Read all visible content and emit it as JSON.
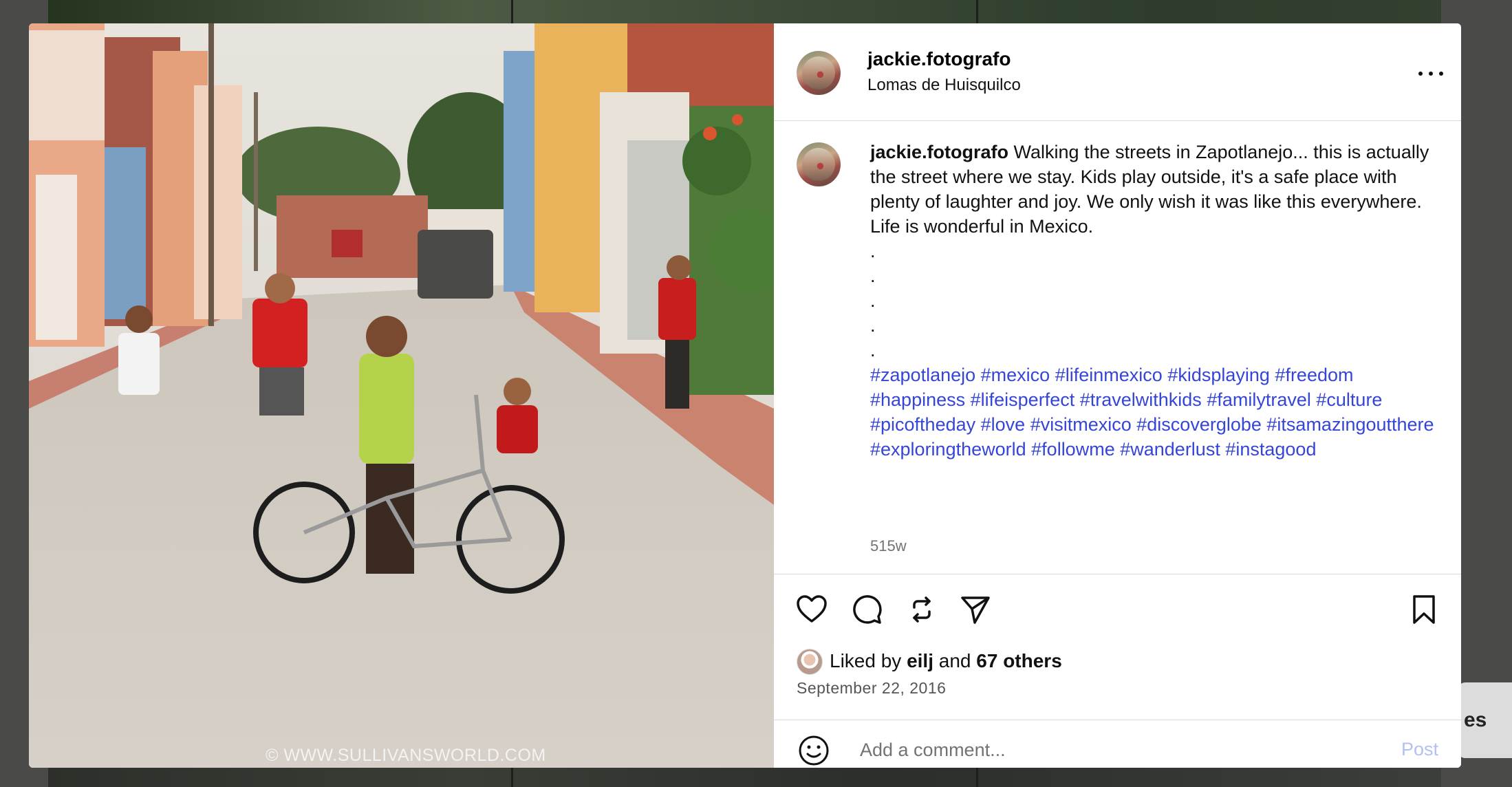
{
  "background": {
    "behind_text": "es"
  },
  "photo": {
    "alt": "Kids playing with a bicycle on a street in Zapotlanejo",
    "watermark": "© WWW.SULLIVANSWORLD.COM"
  },
  "header": {
    "username": "jackie.fotografo",
    "location": "Lomas de Huisquilco",
    "more_icon": "more-horizontal-icon"
  },
  "caption": {
    "username": "jackie.fotografo",
    "text": " Walking the streets in Zapotlanejo... this is actually the street where we stay. Kids play outside, it's a safe place with plenty of laughter and joy. We only wish it was like this everywhere.",
    "line2": "Life is wonderful in Mexico.",
    "dots": [
      ".",
      ".",
      ".",
      ".",
      "."
    ],
    "hashtags": [
      "#zapotlanejo",
      "#mexico",
      "#lifeinmexico",
      "#kidsplaying",
      "#freedom",
      "#happiness",
      "#lifeisperfect",
      "#travelwithkids",
      "#familytravel",
      "#culture",
      "#picoftheday",
      "#love",
      "#visitmexico",
      "#discoverglobe",
      "#itsamazingoutthere",
      "#exploringtheworld",
      "#followme",
      "#wanderlust",
      "#instagood"
    ],
    "time_ago": "515w"
  },
  "actions": {
    "icons": [
      "heart-icon",
      "comment-icon",
      "repost-icon",
      "share-icon",
      "bookmark-icon"
    ],
    "liked_prefix": "Liked by ",
    "liked_user": "eilj",
    "liked_and": " and ",
    "liked_others": "67 others",
    "date": "September 22, 2016"
  },
  "comment": {
    "placeholder": "Add a comment...",
    "post_label": "Post",
    "emoji_icon": "smiley-icon"
  },
  "colors": {
    "hashtag": "#3545d6",
    "post_button_disabled": "#b3bff7",
    "secondary_text": "#737373"
  }
}
